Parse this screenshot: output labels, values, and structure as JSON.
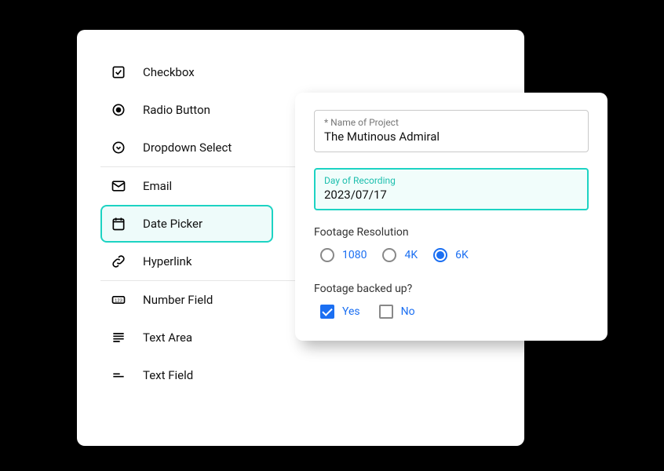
{
  "sidebar": {
    "groups": [
      {
        "items": [
          {
            "key": "checkbox",
            "label": "Checkbox"
          },
          {
            "key": "radio",
            "label": "Radio Button"
          },
          {
            "key": "dropdown",
            "label": "Dropdown Select"
          }
        ]
      },
      {
        "items": [
          {
            "key": "email",
            "label": "Email"
          },
          {
            "key": "date",
            "label": "Date Picker",
            "selected": true
          },
          {
            "key": "hyperlink",
            "label": "Hyperlink"
          }
        ]
      },
      {
        "items": [
          {
            "key": "number",
            "label": "Number Field"
          },
          {
            "key": "textarea",
            "label": "Text Area"
          },
          {
            "key": "textfield",
            "label": "Text Field"
          }
        ]
      }
    ]
  },
  "form": {
    "project": {
      "label": "* Name of Project",
      "value": "The Mutinous Admiral"
    },
    "recording": {
      "label": "Day of Recording",
      "value": "2023/07/17"
    },
    "resolution": {
      "label": "Footage Resolution",
      "options": [
        {
          "label": "1080",
          "checked": false
        },
        {
          "label": "4K",
          "checked": false
        },
        {
          "label": "6K",
          "checked": true
        }
      ]
    },
    "backup": {
      "label": "Footage backed up?",
      "options": [
        {
          "label": "Yes",
          "checked": true
        },
        {
          "label": "No",
          "checked": false
        }
      ]
    }
  }
}
